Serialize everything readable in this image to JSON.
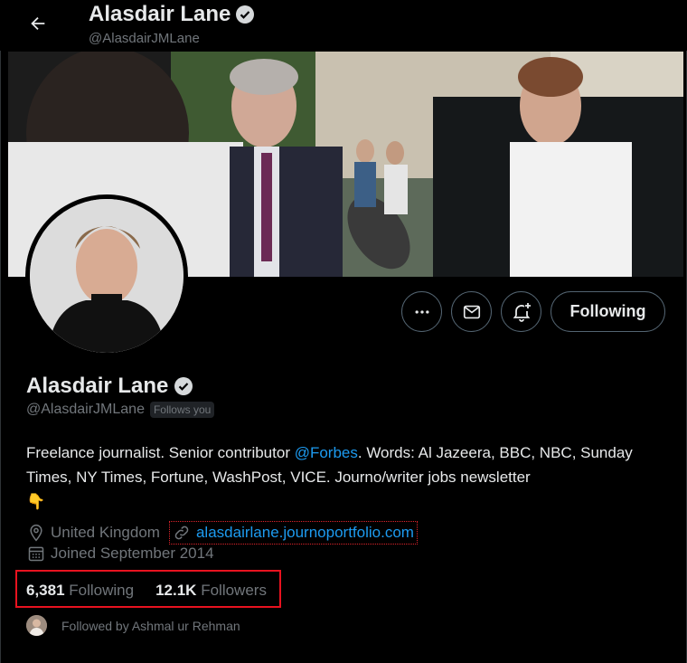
{
  "header": {
    "name": "Alasdair Lane",
    "handle": "@AlasdairJMLane"
  },
  "profile": {
    "name": "Alasdair Lane",
    "handle": "@AlasdairJMLane",
    "follows_you": "Follows you",
    "bio_before": "Freelance journalist. Senior contributor ",
    "bio_mention": "@Forbes",
    "bio_after": ". Words: Al Jazeera, BBC, NBC, Sunday Times, NY Times, Fortune, WashPost, VICE. Journo/writer jobs newsletter",
    "bio_emoji": "👇",
    "location": "United Kingdom",
    "website": "alasdairlane.journoportfolio.com",
    "joined": "Joined September 2014"
  },
  "actions": {
    "follow_label": "Following"
  },
  "stats": {
    "following_count": "6,381",
    "following_label": "Following",
    "followers_count": "12.1K",
    "followers_label": "Followers"
  },
  "followed_by": "Followed by Ashmal ur Rehman",
  "colors": {
    "accent": "#1d9bf0",
    "highlight": "#e8121f"
  }
}
